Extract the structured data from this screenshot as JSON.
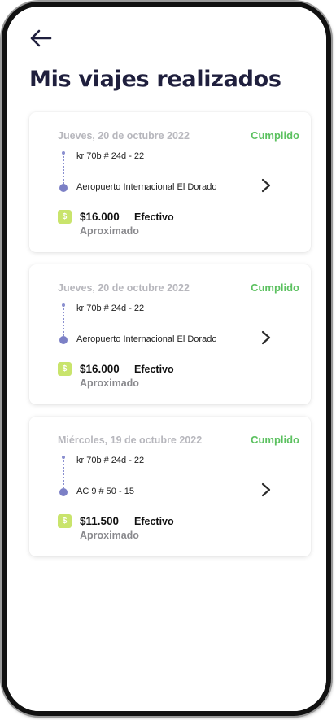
{
  "header": {
    "title": "Mis viajes realizados",
    "back_icon": "arrow-left-icon"
  },
  "colors": {
    "title": "#1f1f3d",
    "status": "#5cc160",
    "date": "#b7b7bd",
    "route": "#7c80c6",
    "price_badge": "#c9e46c"
  },
  "trips": [
    {
      "date": "Jueves, 20 de octubre 2022",
      "status": "Cumplido",
      "origin": "kr 70b # 24d - 22",
      "destination": "Aeropuerto Internacional El Dorado",
      "price_symbol": "$",
      "price": "$16.000",
      "payment": "Efectivo",
      "approx": "Aproximado"
    },
    {
      "date": "Jueves, 20 de octubre 2022",
      "status": "Cumplido",
      "origin": "kr 70b # 24d - 22",
      "destination": "Aeropuerto Internacional El Dorado",
      "price_symbol": "$",
      "price": "$16.000",
      "payment": "Efectivo",
      "approx": "Aproximado"
    },
    {
      "date": "Miércoles, 19 de octubre 2022",
      "status": "Cumplido",
      "origin": "kr 70b # 24d - 22",
      "destination": "AC 9 # 50 - 15",
      "price_symbol": "$",
      "price": "$11.500",
      "payment": "Efectivo",
      "approx": "Aproximado"
    }
  ]
}
